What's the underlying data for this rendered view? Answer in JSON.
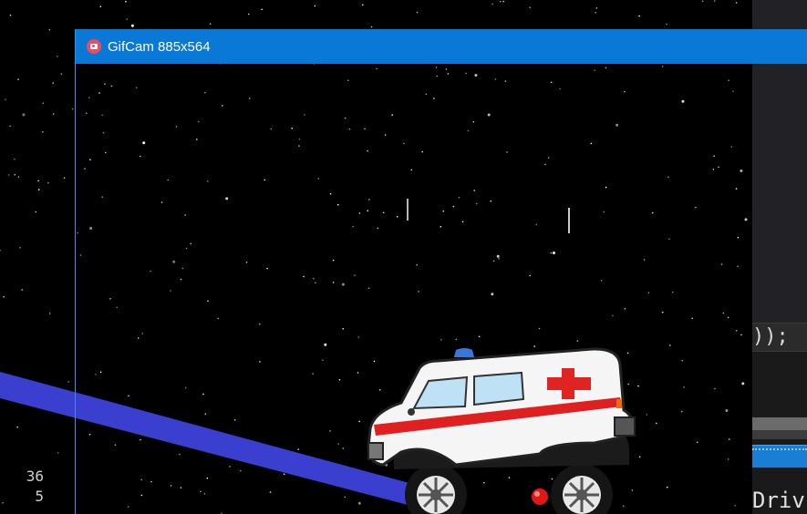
{
  "window": {
    "title": "GifCam 885x564"
  },
  "editor": {
    "code_fragment": "));",
    "bottom_fragment": "Driv"
  },
  "left_gutter": {
    "numbers": [
      "36",
      "5"
    ]
  },
  "game": {
    "vehicle": "ambulance-sprite",
    "colors": {
      "ramp": "#3b3fcf",
      "ball": "#e01818",
      "background": "#000000"
    }
  }
}
